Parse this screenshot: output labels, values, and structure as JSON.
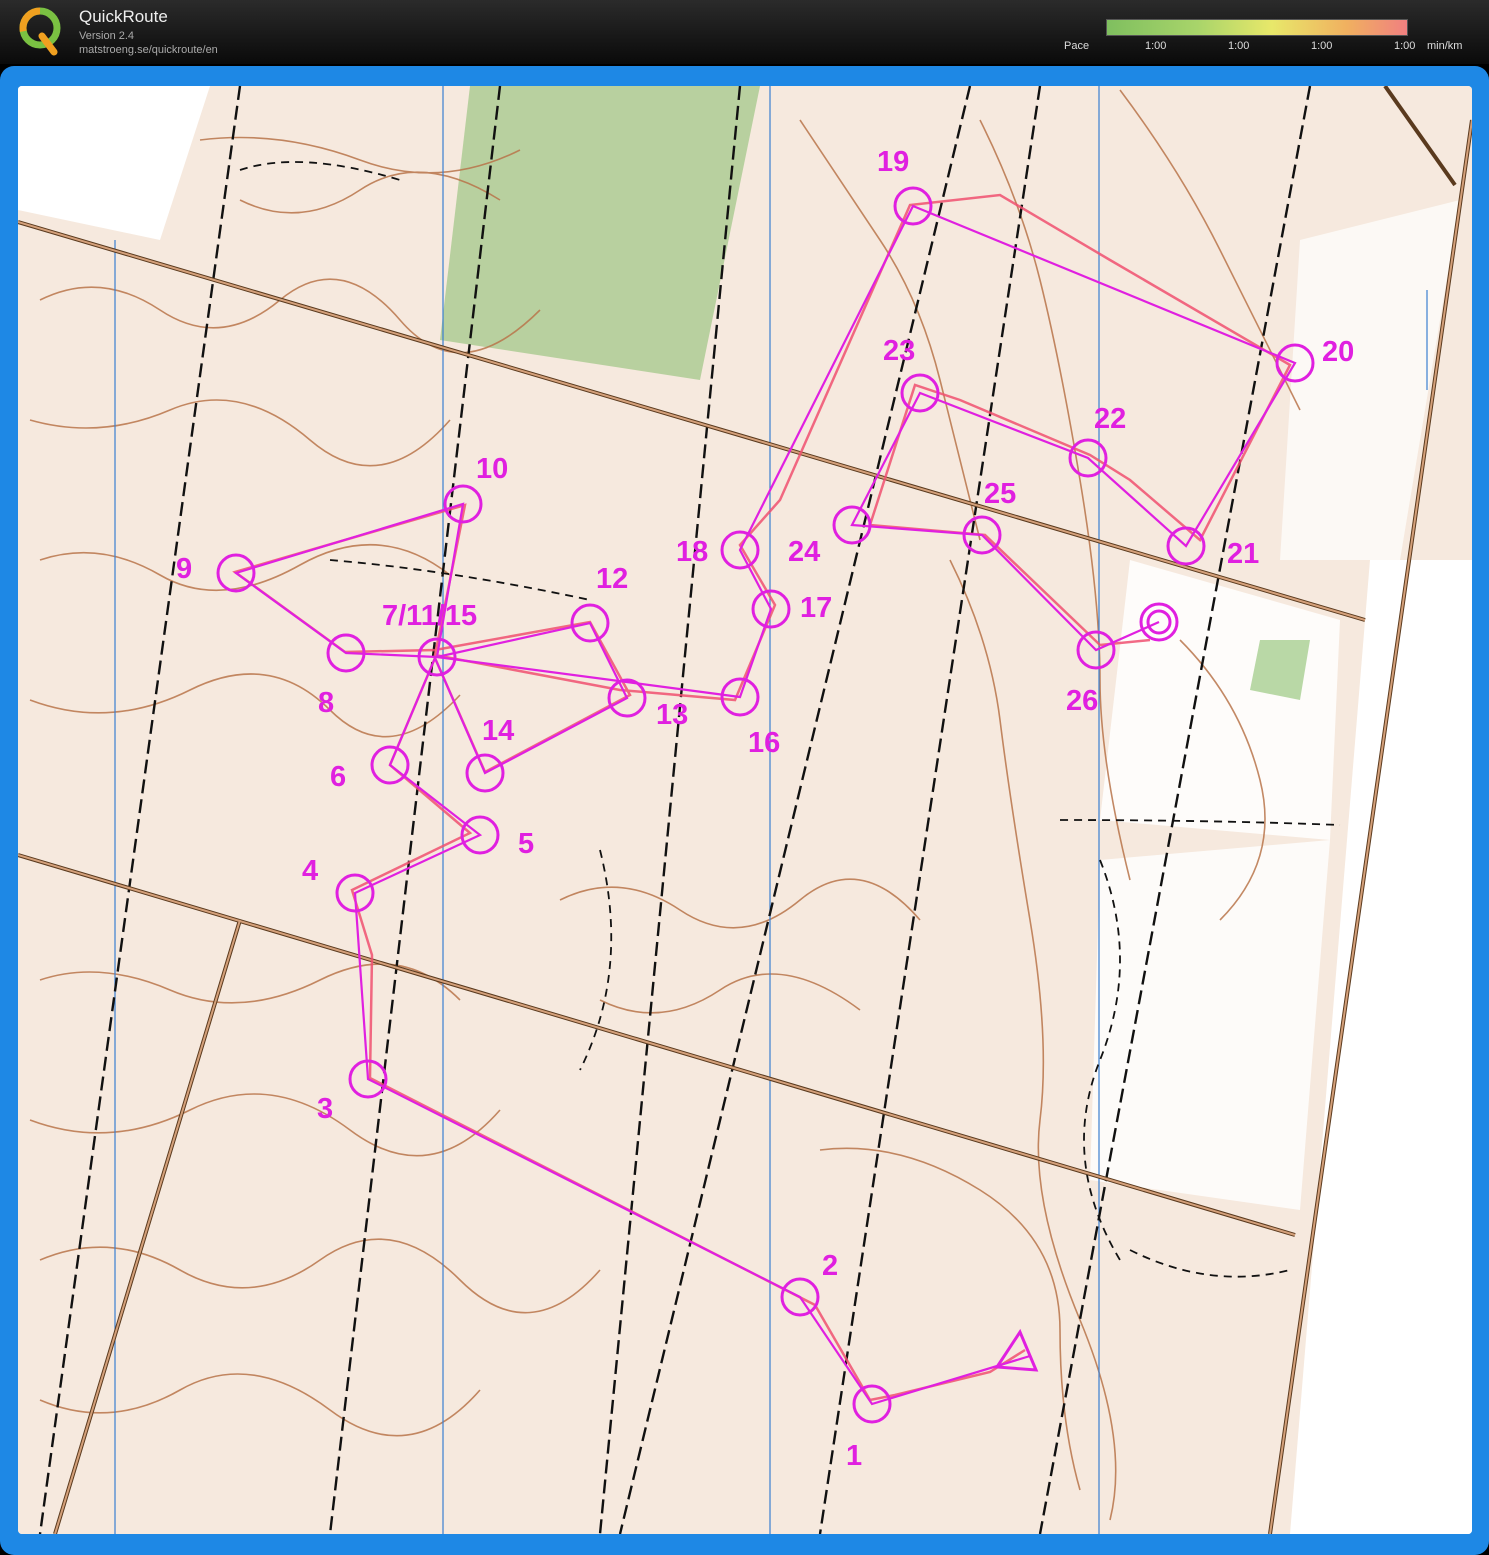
{
  "app": {
    "title": "QuickRoute",
    "version": "Version 2.4",
    "url": "matstroeng.se/quickroute/en"
  },
  "pace_legend": {
    "label": "Pace",
    "ticks": [
      "1:00",
      "1:00",
      "1:00",
      "1:00"
    ],
    "unit": "min/km"
  },
  "colors": {
    "frame": "#1e88e5",
    "course": "#e020e0",
    "route": "#f05070",
    "contour": "#b8744a"
  },
  "course": {
    "start_label": "start-triangle",
    "finish_label": "finish-double-circle",
    "controls": [
      {
        "label": "1"
      },
      {
        "label": "2"
      },
      {
        "label": "3"
      },
      {
        "label": "4"
      },
      {
        "label": "5"
      },
      {
        "label": "6"
      },
      {
        "label": "7/11/15"
      },
      {
        "label": "8"
      },
      {
        "label": "9"
      },
      {
        "label": "10"
      },
      {
        "label": "12"
      },
      {
        "label": "13"
      },
      {
        "label": "14"
      },
      {
        "label": "16"
      },
      {
        "label": "17"
      },
      {
        "label": "18"
      },
      {
        "label": "19"
      },
      {
        "label": "20"
      },
      {
        "label": "21"
      },
      {
        "label": "22"
      },
      {
        "label": "23"
      },
      {
        "label": "24"
      },
      {
        "label": "25"
      },
      {
        "label": "26"
      }
    ]
  }
}
